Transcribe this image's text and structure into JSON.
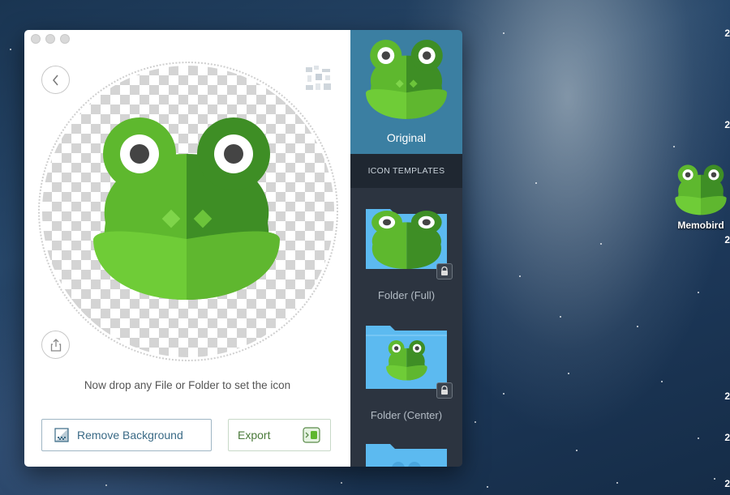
{
  "app": {
    "hint": "Now drop any File or Folder to set the icon",
    "remove_background_label": "Remove Background",
    "export_label": "Export"
  },
  "sidebar": {
    "original_label": "Original",
    "section_header": "ICON TEMPLATES",
    "templates": [
      {
        "label": "Folder (Full)",
        "locked": true
      },
      {
        "label": "Folder (Center)",
        "locked": true
      },
      {
        "label": "",
        "locked": false
      }
    ]
  },
  "desktop": {
    "icon_label": "Memobird",
    "edge_digits": [
      "2",
      "2",
      "2",
      "2",
      "2",
      "2"
    ]
  },
  "icons": {
    "back": "chevron-left-icon",
    "share": "share-icon",
    "remove_bg": "transparency-icon",
    "export": "export-icon",
    "lock": "lock-icon"
  },
  "colors": {
    "frog_light": "#6ac634",
    "frog_dark": "#3e8e25",
    "sidebar_selected": "#3b7fa2",
    "sidebar_bg": "#2c3440",
    "folder_blue": "#5cbaf0"
  }
}
